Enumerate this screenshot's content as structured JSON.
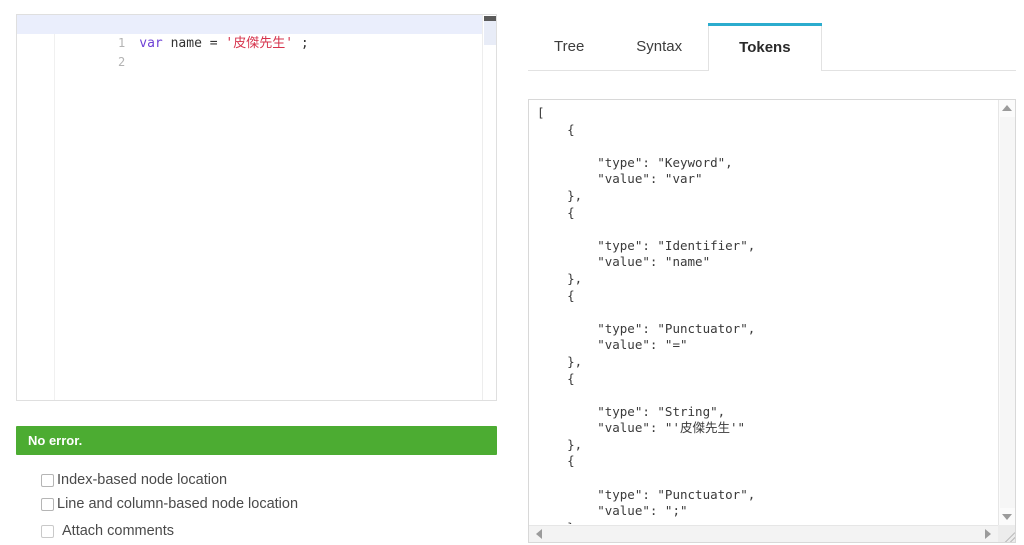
{
  "editor": {
    "lines": [
      {
        "number": "1",
        "active": true,
        "tokens": [
          {
            "text": "var",
            "kind": "keyword"
          },
          {
            "text": " name = ",
            "kind": "plain"
          },
          {
            "text": "'皮傑先生'",
            "kind": "string"
          },
          {
            "text": " ;",
            "kind": "punctuator"
          }
        ],
        "plain": "var name = '皮傑先生' ;"
      },
      {
        "number": "2",
        "active": false,
        "tokens": [],
        "plain": ""
      }
    ],
    "scrollbar": {
      "name": "editor-vertical-scrollbar"
    }
  },
  "status": {
    "message": "No error.",
    "color": "#4cac32"
  },
  "options": [
    {
      "label": "Index-based node location",
      "checked": false
    },
    {
      "label": "Line and column-based node location",
      "checked": false
    },
    {
      "label": "Attach comments",
      "checked": false
    }
  ],
  "tabs": [
    {
      "label": "Tree",
      "active": false
    },
    {
      "label": "Syntax",
      "active": false
    },
    {
      "label": "Tokens",
      "active": true
    }
  ],
  "accent_color": "#2bacce",
  "output": {
    "text": "[\n    {\n\n        \"type\": \"Keyword\",\n        \"value\": \"var\"\n    },\n    {\n\n        \"type\": \"Identifier\",\n        \"value\": \"name\"\n    },\n    {\n\n        \"type\": \"Punctuator\",\n        \"value\": \"=\"\n    },\n    {\n\n        \"type\": \"String\",\n        \"value\": \"'皮傑先生'\"\n    },\n    {\n\n        \"type\": \"Punctuator\",\n        \"value\": \";\"\n    }\n]",
    "tokens": [
      {
        "type": "Keyword",
        "value": "var"
      },
      {
        "type": "Identifier",
        "value": "name"
      },
      {
        "type": "Punctuator",
        "value": "="
      },
      {
        "type": "String",
        "value": "'皮傑先生'"
      },
      {
        "type": "Punctuator",
        "value": ";"
      }
    ]
  }
}
